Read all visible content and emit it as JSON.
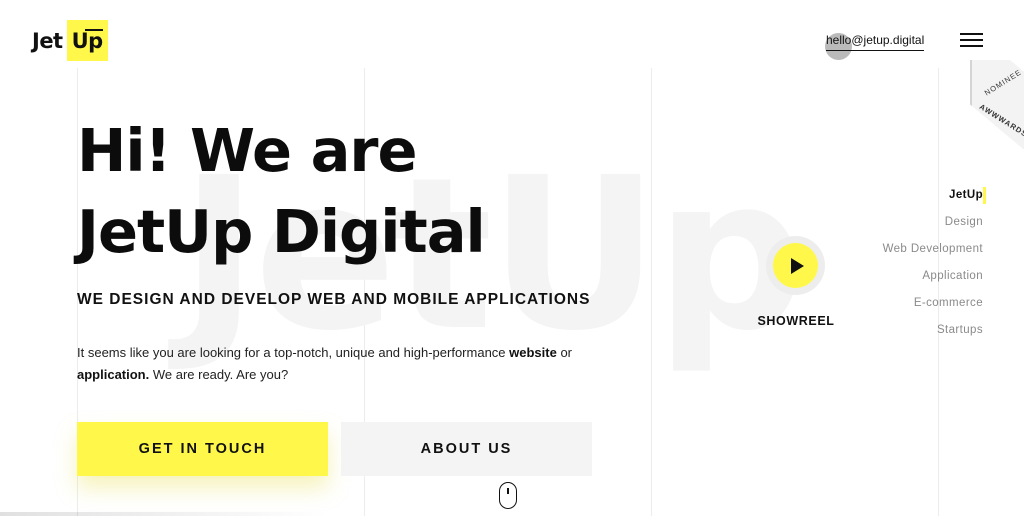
{
  "brand": {
    "logo_part1": "Jet",
    "logo_part2": "Up",
    "accent_color": "#fff84a"
  },
  "header": {
    "email": "hello@jetup.digital",
    "menu_icon": "hamburger-menu-icon"
  },
  "award_badge": {
    "line1": "NOMINEE",
    "line2": "AWWWARDS"
  },
  "background_word": "JetUp",
  "hero": {
    "headline_line1": "Hi! We are",
    "headline_line2": "JetUp Digital",
    "subheadline": "WE DESIGN AND DEVELOP WEB AND MOBILE APPLICATIONS",
    "intro_part1": "It seems like you are looking for a top-notch, unique and high-performance ",
    "intro_bold1": "website",
    "intro_part2": " or ",
    "intro_bold2": "application.",
    "intro_part3": " We are ready. Are you?"
  },
  "buttons": {
    "primary": "GET IN TOUCH",
    "secondary": "ABOUT US"
  },
  "showreel": {
    "label": "SHOWREEL",
    "icon": "play-icon"
  },
  "scroll_indicator_icon": "mouse-scroll-icon",
  "side_nav": {
    "items": [
      {
        "label": "JetUp",
        "active": true
      },
      {
        "label": "Design",
        "active": false
      },
      {
        "label": "Web Development",
        "active": false
      },
      {
        "label": "Application",
        "active": false
      },
      {
        "label": "E-commerce",
        "active": false
      },
      {
        "label": "Startups",
        "active": false
      }
    ]
  }
}
